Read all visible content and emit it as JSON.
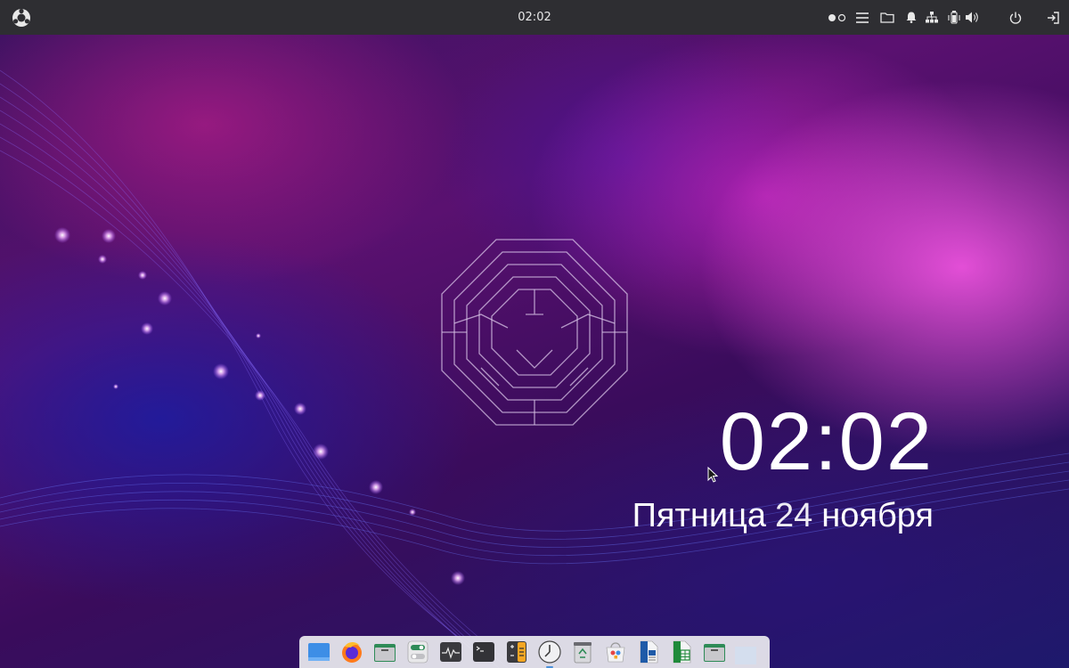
{
  "topbar": {
    "clock": "02:02",
    "icons": [
      {
        "name": "ubuntu-unity-logo-icon"
      },
      {
        "name": "workspace-indicator-icon"
      },
      {
        "name": "menu-lines-icon"
      },
      {
        "name": "folder-icon"
      },
      {
        "name": "bell-icon"
      },
      {
        "name": "network-icon"
      },
      {
        "name": "battery-icon"
      },
      {
        "name": "volume-icon"
      },
      {
        "name": "power-icon"
      },
      {
        "name": "logout-icon"
      }
    ]
  },
  "desktop": {
    "clock": "02:02",
    "weekday": "Пятница",
    "day": "24",
    "month": "ноября"
  },
  "dock": {
    "apps": [
      {
        "icon": "show-desktop-icon"
      },
      {
        "icon": "firefox-icon"
      },
      {
        "icon": "files-icon"
      },
      {
        "icon": "settings-toggle-icon"
      },
      {
        "icon": "system-monitor-icon"
      },
      {
        "icon": "terminal-icon"
      },
      {
        "icon": "calculator-icon"
      },
      {
        "icon": "clock-icon"
      },
      {
        "icon": "trash-recycle-icon"
      },
      {
        "icon": "software-store-icon"
      },
      {
        "icon": "writer-document-icon"
      },
      {
        "icon": "spreadsheet-icon"
      },
      {
        "icon": "file-manager-icon"
      }
    ]
  },
  "colors": {
    "topbar": "#2e2e32",
    "accent_pink": "#ff5aeb",
    "accent_blue": "#1c1a6a"
  }
}
